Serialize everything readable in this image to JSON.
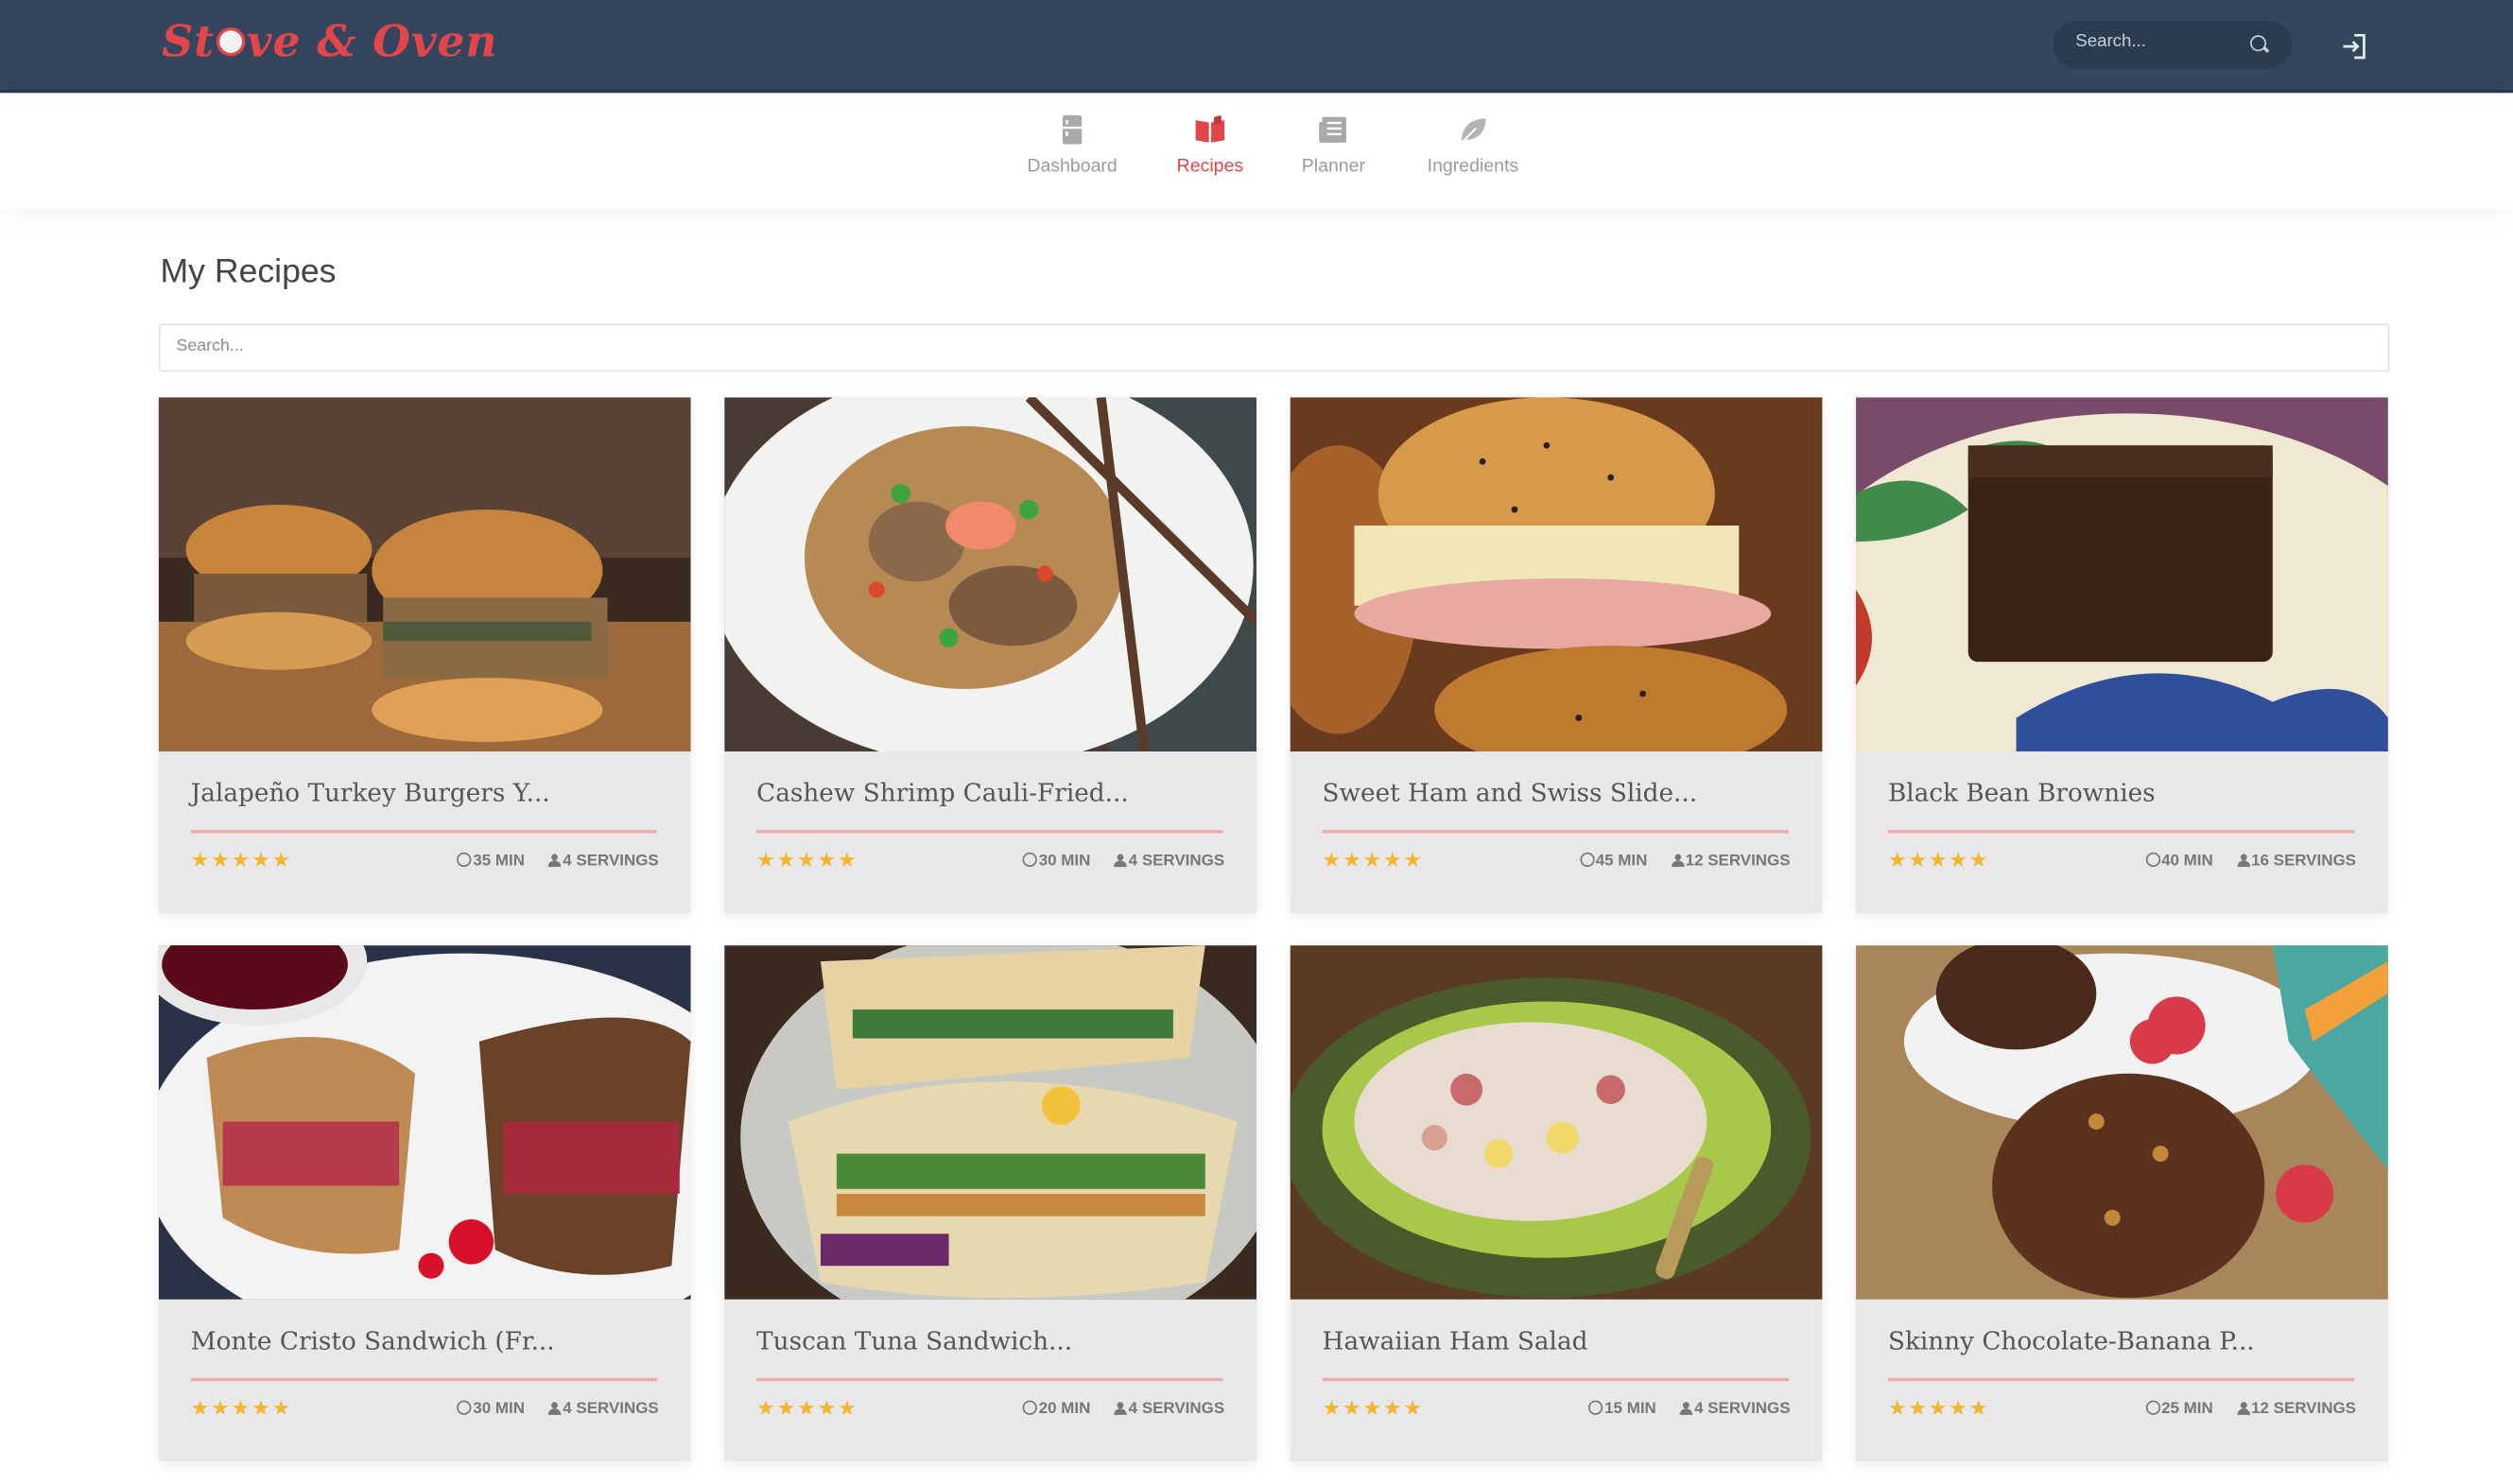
{
  "brand": {
    "name_part1": "St",
    "name_part2": "ve & Oven",
    "color": "#e2454a"
  },
  "header": {
    "search_placeholder": "Search...",
    "logout_icon": "sign-in-icon"
  },
  "nav": [
    {
      "label": "Dashboard",
      "icon": "fridge-icon"
    },
    {
      "label": "Recipes",
      "icon": "open-book-icon",
      "active": true
    },
    {
      "label": "Planner",
      "icon": "newspaper-icon"
    },
    {
      "label": "Ingredients",
      "icon": "leaf-icon"
    }
  ],
  "page": {
    "title": "My Recipes",
    "search_placeholder": "Search..."
  },
  "recipes": [
    {
      "title": "Jalapeño Turkey Burgers Y...",
      "stars": "★★★★★",
      "time": "35 MIN",
      "servings": "4 SERVINGS"
    },
    {
      "title": "Cashew Shrimp Cauli-Fried...",
      "stars": "★★★★★",
      "time": "30 MIN",
      "servings": "4 SERVINGS"
    },
    {
      "title": "Sweet Ham and Swiss Slide...",
      "stars": "★★★★★",
      "time": "45 MIN",
      "servings": "12 SERVINGS"
    },
    {
      "title": "Black Bean Brownies",
      "stars": "★★★★★",
      "time": "40 MIN",
      "servings": "16 SERVINGS"
    },
    {
      "title": "Monte Cristo Sandwich (Fr...",
      "stars": "★★★★★",
      "time": "30 MIN",
      "servings": "4 SERVINGS"
    },
    {
      "title": "Tuscan Tuna Sandwich...",
      "stars": "★★★★★",
      "time": "20 MIN",
      "servings": "4 SERVINGS"
    },
    {
      "title": "Hawaiian Ham Salad",
      "stars": "★★★★★",
      "time": "15 MIN",
      "servings": "4 SERVINGS"
    },
    {
      "title": "Skinny Chocolate-Banana P...",
      "stars": "★★★★★",
      "time": "25 MIN",
      "servings": "12 SERVINGS"
    }
  ]
}
